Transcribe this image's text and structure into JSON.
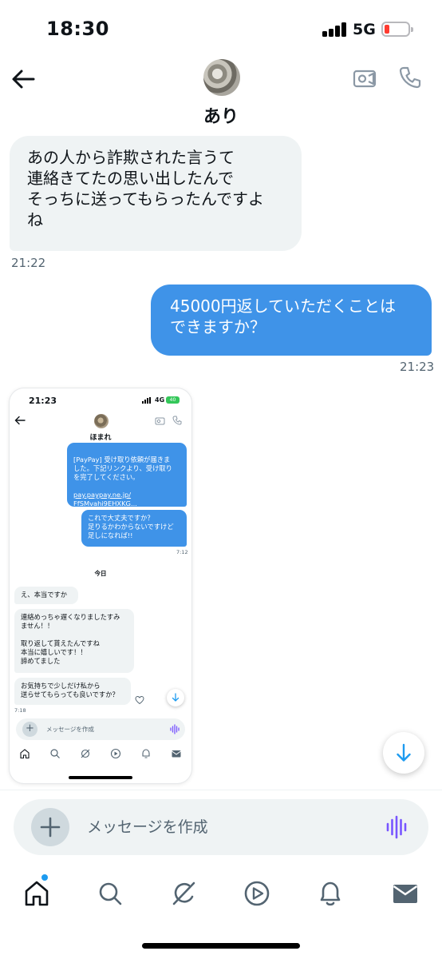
{
  "status_bar": {
    "time": "18:30",
    "network": "5G"
  },
  "header": {
    "contact_name": "あり"
  },
  "messages": [
    {
      "direction": "in",
      "text": "あの人から詐欺された言うて\n連絡きてたの思い出したんで\nそっちに送ってもらったんですよ\nね",
      "time": "21:22"
    },
    {
      "direction": "out",
      "text": "45000円返していただくことは\nできますか？",
      "time": "21:23"
    }
  ],
  "embedded_screenshot": {
    "status_time": "21:23",
    "network": "4G",
    "battery": "40",
    "contact_name": "ほまれ",
    "messages": [
      {
        "direction": "out",
        "text": "[PayPay] 受け取り依頼が届きま\nした。下記リンクより、受け取り\nを完了してください。",
        "link": "pay.paypay.ne.jp/\nFfSMvahi9EHXKG..."
      },
      {
        "direction": "out",
        "text": "これで大丈夫ですか？\n足りるかわからないですけど\n足しになれば!!",
        "time": "7:12"
      },
      {
        "direction": "in",
        "text": "え、本当ですか"
      },
      {
        "direction": "in",
        "text": "連絡めっちゃ遅くなりましたすみ\nません！！\n\n取り返して貰えたんですね\n本当に嬉しいです！！\n諦めてました"
      },
      {
        "direction": "in",
        "text": "お気持ちで少しだけ私から\n送らせてもらっても良いですか？",
        "time": "7:18"
      }
    ],
    "date_divider": "今日",
    "composer_placeholder": "メッセージを作成"
  },
  "composer": {
    "placeholder": "メッセージを作成"
  },
  "icons": {
    "back": "arrow-left-icon",
    "video": "video-camera-icon",
    "call": "phone-icon",
    "add": "plus-icon",
    "voice": "voice-waveform-icon",
    "scroll_down": "arrow-down-icon",
    "nav": [
      "home-icon",
      "search-icon",
      "grok-icon",
      "play-icon",
      "bell-icon",
      "mail-icon"
    ]
  },
  "colors": {
    "accent": "#1d9bf0",
    "outgoing_bubble": "#3f93e8",
    "incoming_bubble": "#eff3f4",
    "voice": "#7856ff"
  }
}
